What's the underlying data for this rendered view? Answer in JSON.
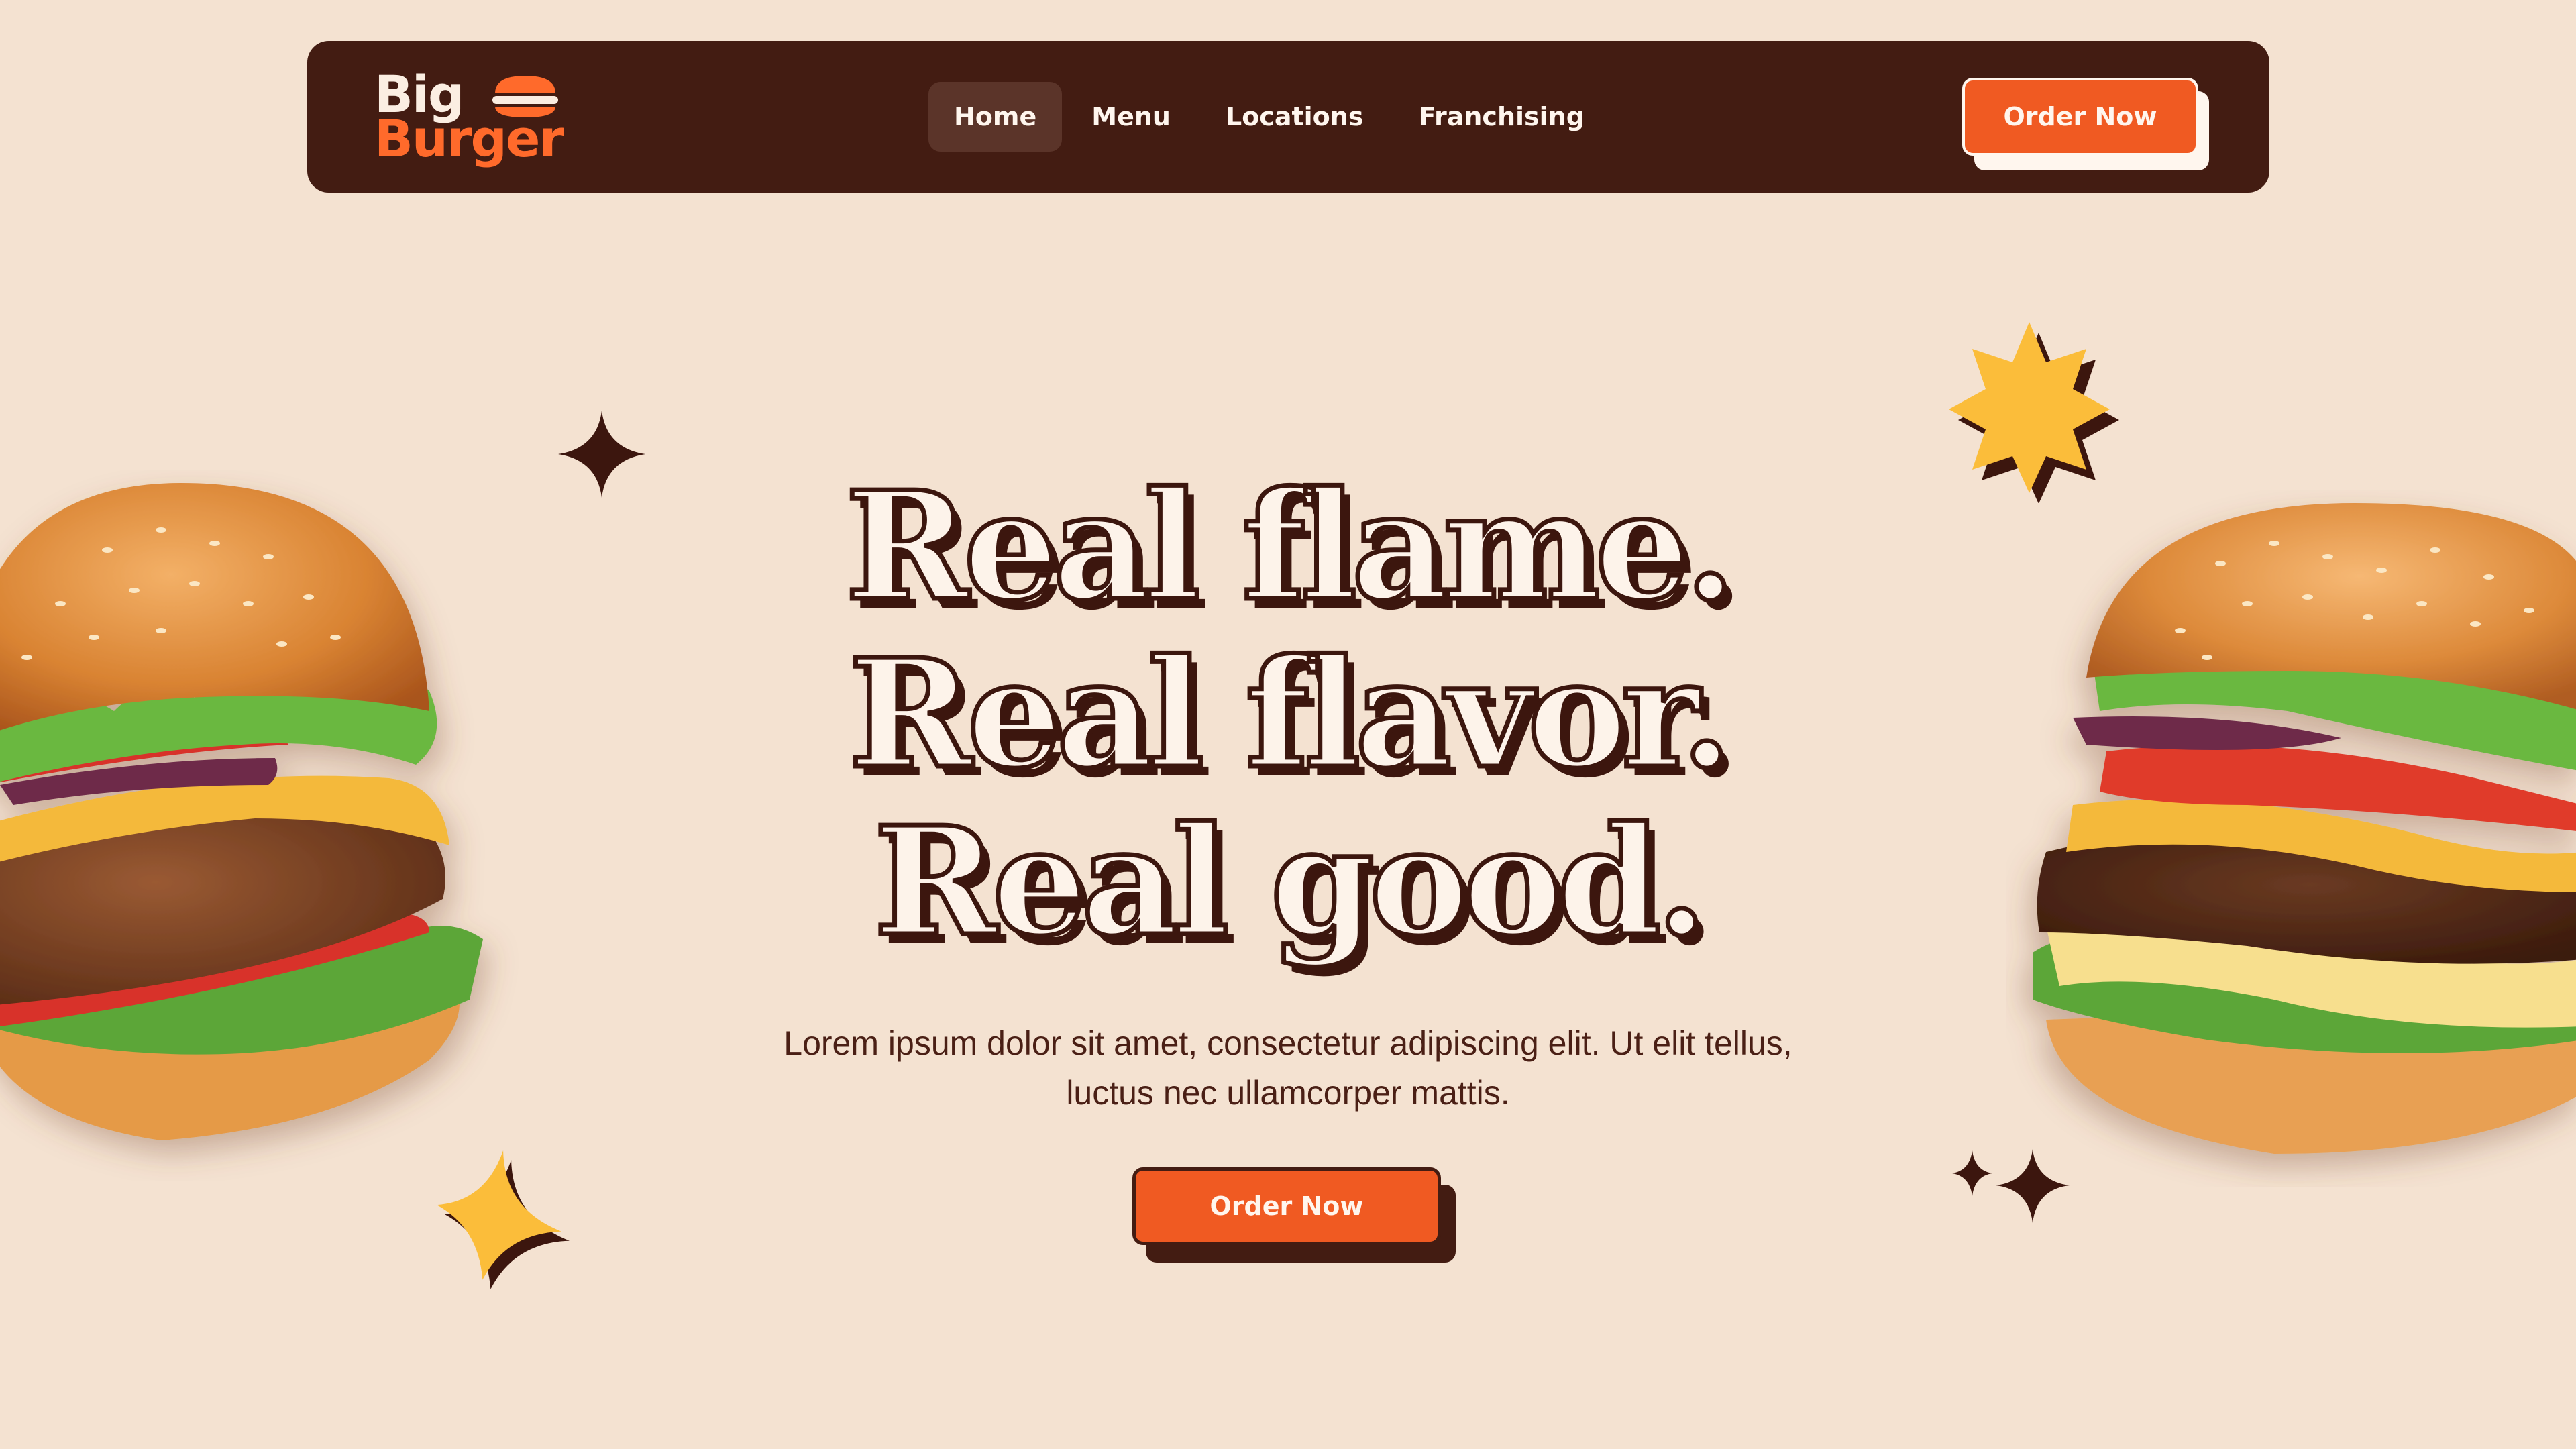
{
  "brand": {
    "line1": "Big",
    "line2": "Burger",
    "logo_icon": "burger-icon"
  },
  "nav": {
    "items": [
      {
        "label": "Home",
        "active": true
      },
      {
        "label": "Menu",
        "active": false
      },
      {
        "label": "Locations",
        "active": false
      },
      {
        "label": "Franchising",
        "active": false
      }
    ],
    "cta_label": "Order Now"
  },
  "hero": {
    "headline": [
      "Real flame.",
      "Real flavor.",
      "Real good."
    ],
    "subtext": "Lorem ipsum dolor sit amet, consectetur adipiscing elit. Ut elit tellus, luctus nec ullamcorper mattis.",
    "cta_label": "Order Now"
  },
  "decorations": {
    "left_image": "burger-image",
    "right_image": "burger-image",
    "shapes": [
      "sparkle-icon",
      "starburst-icon",
      "star-icon",
      "sparkle-icon"
    ]
  },
  "colors": {
    "background": "#f4e2d1",
    "navbar": "#431c12",
    "accent": "#f05a22",
    "text_dark": "#4a1f15",
    "yellow": "#fbbd3a"
  }
}
